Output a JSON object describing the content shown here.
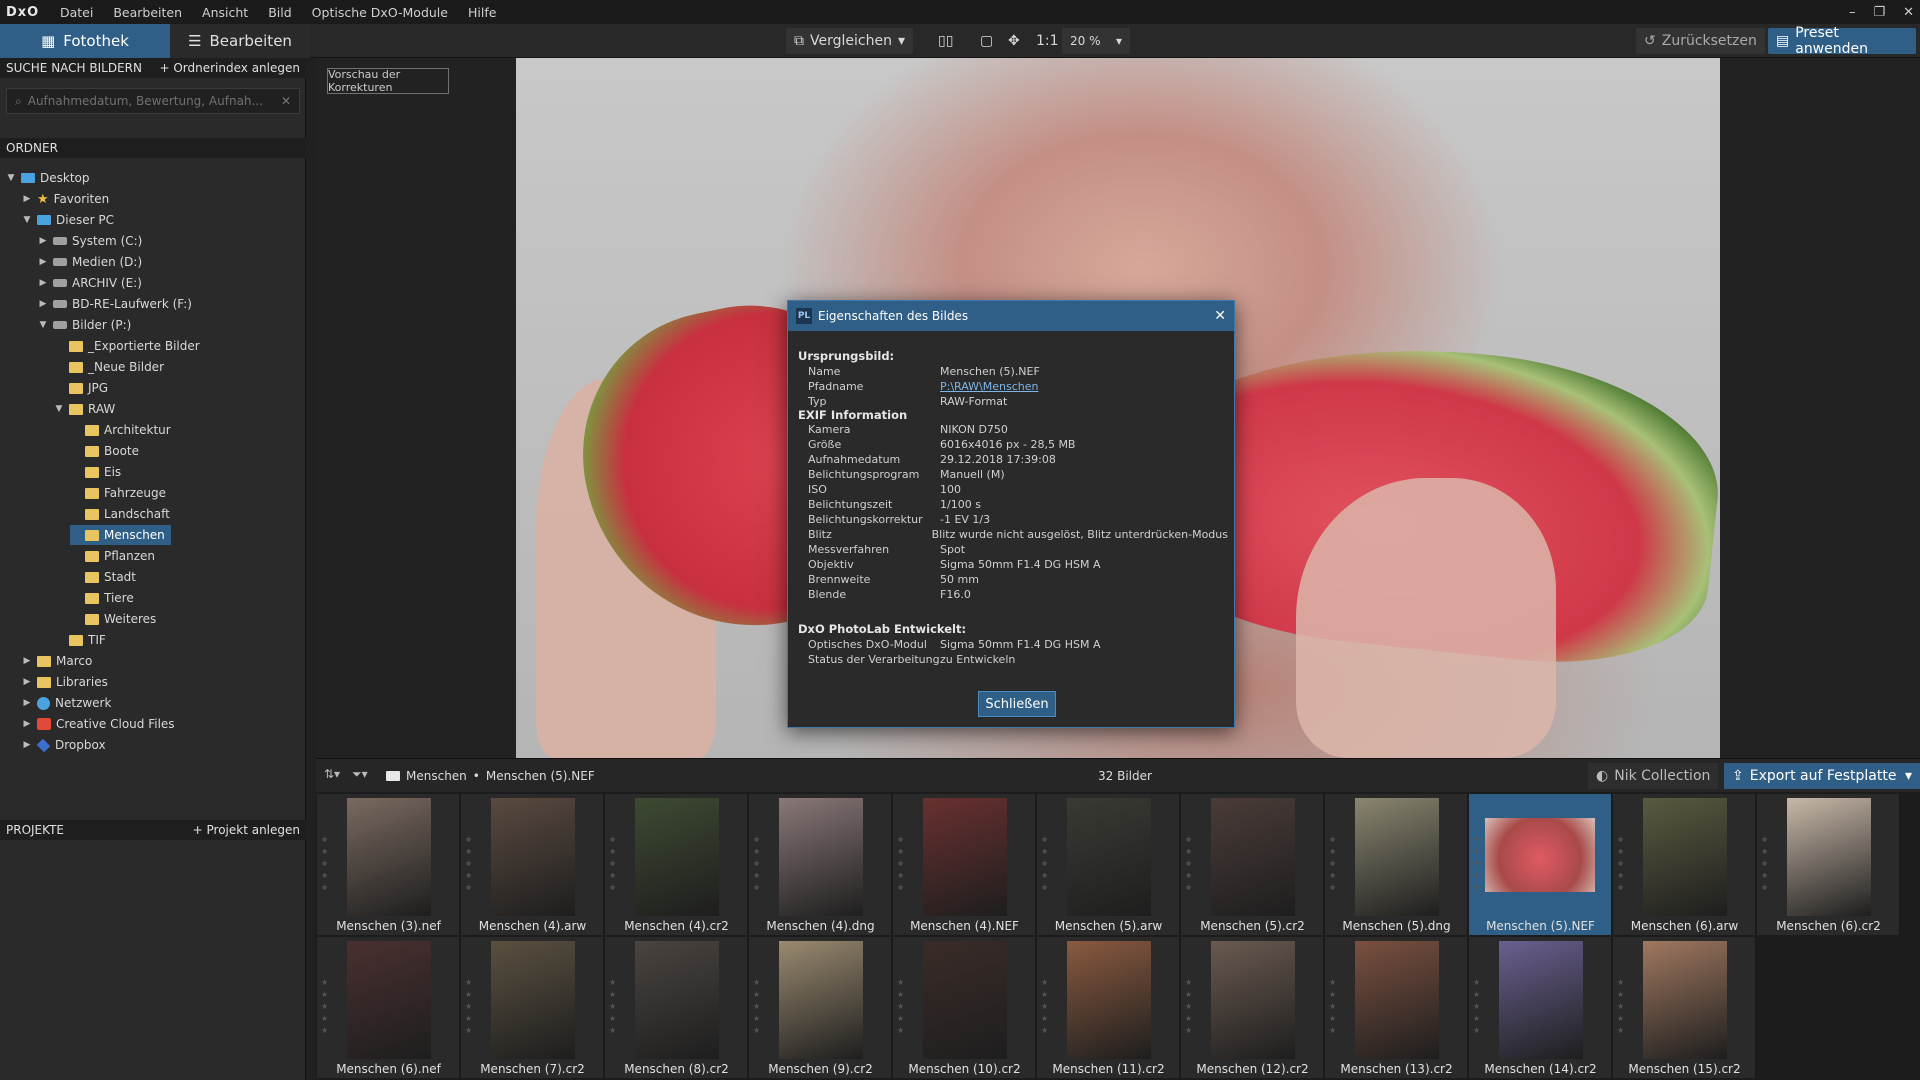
{
  "menubar": {
    "logo": "DxO",
    "items": [
      "Datei",
      "Bearbeiten",
      "Ansicht",
      "Bild",
      "Optische DxO-Module",
      "Hilfe"
    ],
    "win_controls": [
      "–",
      "❐",
      "✕"
    ]
  },
  "toolbar": {
    "tab_fotothek": "Fotothek",
    "tab_bearbeiten": "Bearbeiten",
    "compare": "Vergleichen",
    "one_to_one": "1:1",
    "zoom": "20 %",
    "reset": "Zurücksetzen",
    "preset": "Preset anwenden"
  },
  "left_panel": {
    "search_header": "SUCHE NACH BILDERN",
    "add_index": "+ Ordnerindex anlegen",
    "search_placeholder": "Aufnahmedatum, Bewertung, Aufnah...",
    "folders_header": "ORDNER",
    "tree": [
      {
        "label": "Desktop",
        "level": 0,
        "arrow": "▼",
        "icon": "pc"
      },
      {
        "label": "Favoriten",
        "level": 1,
        "arrow": "▶",
        "icon": "star"
      },
      {
        "label": "Dieser PC",
        "level": 1,
        "arrow": "▼",
        "icon": "pc"
      },
      {
        "label": "System (C:)",
        "level": 2,
        "arrow": "▶",
        "icon": "drive"
      },
      {
        "label": "Medien (D:)",
        "level": 2,
        "arrow": "▶",
        "icon": "drive"
      },
      {
        "label": "ARCHIV (E:)",
        "level": 2,
        "arrow": "▶",
        "icon": "drive"
      },
      {
        "label": "BD-RE-Laufwerk (F:)",
        "level": 2,
        "arrow": "▶",
        "icon": "drive"
      },
      {
        "label": "Bilder (P:)",
        "level": 2,
        "arrow": "▼",
        "icon": "drive"
      },
      {
        "label": "_Exportierte Bilder",
        "level": 3,
        "arrow": "",
        "icon": "folder"
      },
      {
        "label": "_Neue Bilder",
        "level": 3,
        "arrow": "",
        "icon": "folder"
      },
      {
        "label": "JPG",
        "level": 3,
        "arrow": "",
        "icon": "folder"
      },
      {
        "label": "RAW",
        "level": 3,
        "arrow": "▼",
        "icon": "folder"
      },
      {
        "label": "Architektur",
        "level": 4,
        "arrow": "",
        "icon": "folder"
      },
      {
        "label": "Boote",
        "level": 4,
        "arrow": "",
        "icon": "folder"
      },
      {
        "label": "Eis",
        "level": 4,
        "arrow": "",
        "icon": "folder"
      },
      {
        "label": "Fahrzeuge",
        "level": 4,
        "arrow": "",
        "icon": "folder"
      },
      {
        "label": "Landschaft",
        "level": 4,
        "arrow": "",
        "icon": "folder"
      },
      {
        "label": "Menschen",
        "level": 4,
        "arrow": "",
        "icon": "folder",
        "selected": true
      },
      {
        "label": "Pflanzen",
        "level": 4,
        "arrow": "",
        "icon": "folder"
      },
      {
        "label": "Stadt",
        "level": 4,
        "arrow": "",
        "icon": "folder"
      },
      {
        "label": "Tiere",
        "level": 4,
        "arrow": "",
        "icon": "folder"
      },
      {
        "label": "Weiteres",
        "level": 4,
        "arrow": "",
        "icon": "folder"
      },
      {
        "label": "TIF",
        "level": 3,
        "arrow": "",
        "icon": "folder"
      },
      {
        "label": "Marco",
        "level": 1,
        "arrow": "▶",
        "icon": "folder"
      },
      {
        "label": "Libraries",
        "level": 1,
        "arrow": "▶",
        "icon": "folder"
      },
      {
        "label": "Netzwerk",
        "level": 1,
        "arrow": "▶",
        "icon": "globe"
      },
      {
        "label": "Creative Cloud Files",
        "level": 1,
        "arrow": "▶",
        "icon": "cc"
      },
      {
        "label": "Dropbox",
        "level": 1,
        "arrow": "▶",
        "icon": "dropbox"
      }
    ],
    "projects_header": "PROJEKTE",
    "add_project": "+ Projekt anlegen"
  },
  "viewer": {
    "preview_button": "Vorschau der Korrekturen"
  },
  "dialog": {
    "title": "Eigenschaften des Bildes",
    "section_source": "Ursprungsbild:",
    "source_rows": [
      {
        "key": "Name",
        "value": "Menschen (5).NEF"
      },
      {
        "key": "Pfadname",
        "value": "P:\\RAW\\Menschen",
        "link": true
      },
      {
        "key": "Typ",
        "value": "RAW-Format"
      }
    ],
    "section_exif": "EXIF Information",
    "exif_rows": [
      {
        "key": "Kamera",
        "value": "NIKON D750"
      },
      {
        "key": "Größe",
        "value": "6016x4016  px - 28,5 MB"
      },
      {
        "key": "Aufnahmedatum",
        "value": "29.12.2018 17:39:08"
      },
      {
        "key": "Belichtungsprogram",
        "value": "Manuell (M)"
      },
      {
        "key": "ISO",
        "value": "100"
      },
      {
        "key": "Belichtungszeit",
        "value": "1/100 s"
      },
      {
        "key": "Belichtungskorrektur",
        "value": "-1 EV 1/3"
      },
      {
        "key": "Blitz",
        "value": "Blitz wurde nicht ausgelöst, Blitz unterdrücken-Modus"
      },
      {
        "key": "Messverfahren",
        "value": "Spot"
      },
      {
        "key": "Objektiv",
        "value": "Sigma 50mm F1.4 DG HSM A"
      },
      {
        "key": "Brennweite",
        "value": "50  mm"
      },
      {
        "key": "Blende",
        "value": "F16.0"
      }
    ],
    "section_dxo": "DxO PhotoLab Entwickelt:",
    "dxo_rows": [
      {
        "key": "Optisches DxO-Modul",
        "value": "Sigma 50mm F1.4 DG HSM A"
      },
      {
        "key": "Status der Verarbeitung",
        "value": "zu Entwickeln"
      }
    ],
    "close_button": "Schließen"
  },
  "browser_bar": {
    "crumb_folder": "Menschen",
    "crumb_sep": "•",
    "crumb_file": "Menschen (5).NEF",
    "count": "32 Bilder",
    "nik": "Nik Collection",
    "export": "Export auf Festplatte"
  },
  "thumbnails": [
    {
      "name": "Menschen (3).nef",
      "color": "#7a6a60"
    },
    {
      "name": "Menschen (4).arw",
      "color": "#5a4a40"
    },
    {
      "name": "Menschen (4).cr2",
      "color": "#3e4a32"
    },
    {
      "name": "Menschen (4).dng",
      "color": "#8a7878"
    },
    {
      "name": "Menschen (4).NEF",
      "color": "#6a3030"
    },
    {
      "name": "Menschen (5).arw",
      "color": "#3a3a34"
    },
    {
      "name": "Menschen (5).cr2",
      "color": "#4a3c38"
    },
    {
      "name": "Menschen (5).dng",
      "color": "#8a8670"
    },
    {
      "name": "Menschen (5).NEF",
      "color": "#c85050",
      "selected": true
    },
    {
      "name": "Menschen (6).arw",
      "color": "#5a5a40"
    },
    {
      "name": "Menschen (6).cr2",
      "color": "#c8b8a8"
    },
    {
      "name": "Menschen (6).nef",
      "color": "#4a3030"
    },
    {
      "name": "Menschen (7).cr2",
      "color": "#5a5040"
    },
    {
      "name": "Menschen (8).cr2",
      "color": "#4a4440"
    },
    {
      "name": "Menschen (9).cr2",
      "color": "#9a8a70"
    },
    {
      "name": "Menschen (10).cr2",
      "color": "#3a2c28"
    },
    {
      "name": "Menschen (11).cr2",
      "color": "#8a5a40"
    },
    {
      "name": "Menschen (12).cr2",
      "color": "#6a5a50"
    },
    {
      "name": "Menschen (13).cr2",
      "color": "#7a5040"
    },
    {
      "name": "Menschen (14).cr2",
      "color": "#6a6090"
    },
    {
      "name": "Menschen (15).cr2",
      "color": "#a07860"
    }
  ]
}
